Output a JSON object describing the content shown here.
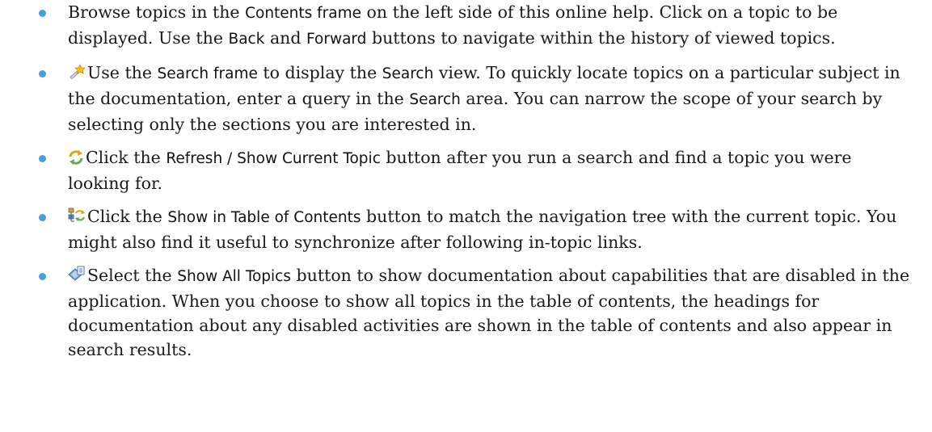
{
  "items": [
    {
      "icon": null,
      "parts": [
        {
          "t": "Browse topics in the "
        },
        {
          "t": "Contents frame",
          "ui": true
        },
        {
          "t": " on the left side of this online help. Click on a topic to be displayed. Use the "
        },
        {
          "t": "Back",
          "ui": true
        },
        {
          "t": " and "
        },
        {
          "t": "Forward",
          "ui": true
        },
        {
          "t": " buttons to navigate within the history of viewed topics."
        }
      ]
    },
    {
      "icon": "search-wand-icon",
      "parts": [
        {
          "t": "Use the "
        },
        {
          "t": "Search frame",
          "ui": true
        },
        {
          "t": " to display the "
        },
        {
          "t": "Search",
          "ui": true
        },
        {
          "t": " view. To quickly locate topics on a particular subject in the documentation, enter a query in the "
        },
        {
          "t": "Search",
          "ui": true
        },
        {
          "t": " area. You can narrow the scope of your search by selecting only the sections you are interested in."
        }
      ]
    },
    {
      "icon": "refresh-icon",
      "parts": [
        {
          "t": "Click the "
        },
        {
          "t": "Refresh / Show Current Topic",
          "ui": true
        },
        {
          "t": " button after you run a search and find a topic you were looking for."
        }
      ]
    },
    {
      "icon": "sync-toc-icon",
      "parts": [
        {
          "t": "Click the "
        },
        {
          "t": "Show in Table of Contents",
          "ui": true
        },
        {
          "t": " button to match the navigation tree with the current topic. You might also find it useful to synchronize after following in-topic links."
        }
      ]
    },
    {
      "icon": "show-all-topics-icon",
      "parts": [
        {
          "t": "Select the "
        },
        {
          "t": "Show All Topics",
          "ui": true
        },
        {
          "t": " button to show documentation about capabilities that are disabled in the application. When you choose to show all topics in the table of contents, the headings for documentation about any disabled activities are shown in the table of contents and also appear in search results."
        }
      ]
    }
  ]
}
